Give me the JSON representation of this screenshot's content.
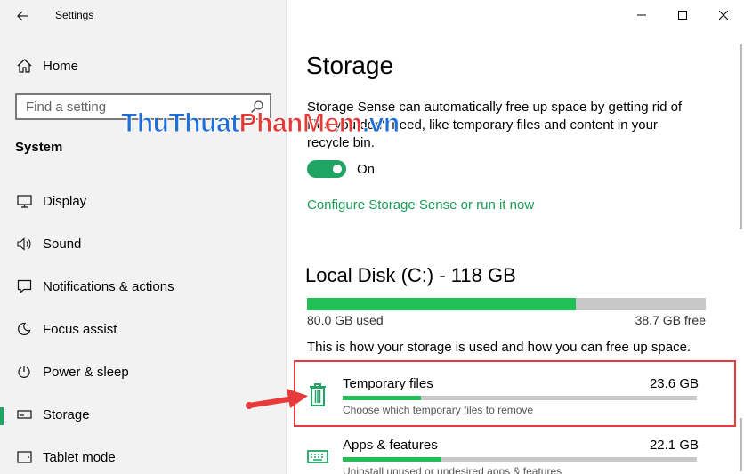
{
  "window": {
    "title": "Settings",
    "controls": [
      "minimize-icon",
      "maximize-icon",
      "close-icon"
    ]
  },
  "sidebar": {
    "home_label": "Home",
    "search_placeholder": "Find a setting",
    "section_title": "System",
    "items": [
      {
        "label": "Display",
        "icon": "display-icon"
      },
      {
        "label": "Sound",
        "icon": "sound-icon"
      },
      {
        "label": "Notifications & actions",
        "icon": "notifications-icon"
      },
      {
        "label": "Focus assist",
        "icon": "focus-assist-icon"
      },
      {
        "label": "Power & sleep",
        "icon": "power-icon"
      },
      {
        "label": "Storage",
        "icon": "storage-icon",
        "selected": true
      },
      {
        "label": "Tablet mode",
        "icon": "tablet-icon"
      }
    ]
  },
  "main": {
    "title": "Storage",
    "description_line1": "Storage Sense can automatically free up space by getting rid of",
    "description_line2": "files you don't need, like temporary files and content in your",
    "description_line3": "recycle bin.",
    "toggle_state": "On",
    "configure_link": "Configure Storage Sense or run it now",
    "disk": {
      "title": "Local Disk (C:) - 118 GB",
      "used": "80.0 GB used",
      "free": "38.7 GB free",
      "used_fraction": 0.674
    },
    "how_text": "This is how your storage is used and how you can free up space.",
    "categories": [
      {
        "name": "Temporary files",
        "size": "23.6 GB",
        "subtitle": "Choose which temporary files to remove",
        "fraction": 0.22,
        "icon": "trash-icon"
      },
      {
        "name": "Apps & features",
        "size": "22.1 GB",
        "subtitle": "Uninstall unused or undesired apps & features",
        "fraction": 0.28,
        "icon": "keyboard-icon"
      }
    ]
  },
  "watermark": {
    "part1": "ThuThuat",
    "part2": "PhanMem",
    "part3": ".vn"
  },
  "colors": {
    "accent": "#1fa463",
    "bar_fill": "#1fc056",
    "highlight": "#e83a3a",
    "link": "#1a9d55"
  }
}
